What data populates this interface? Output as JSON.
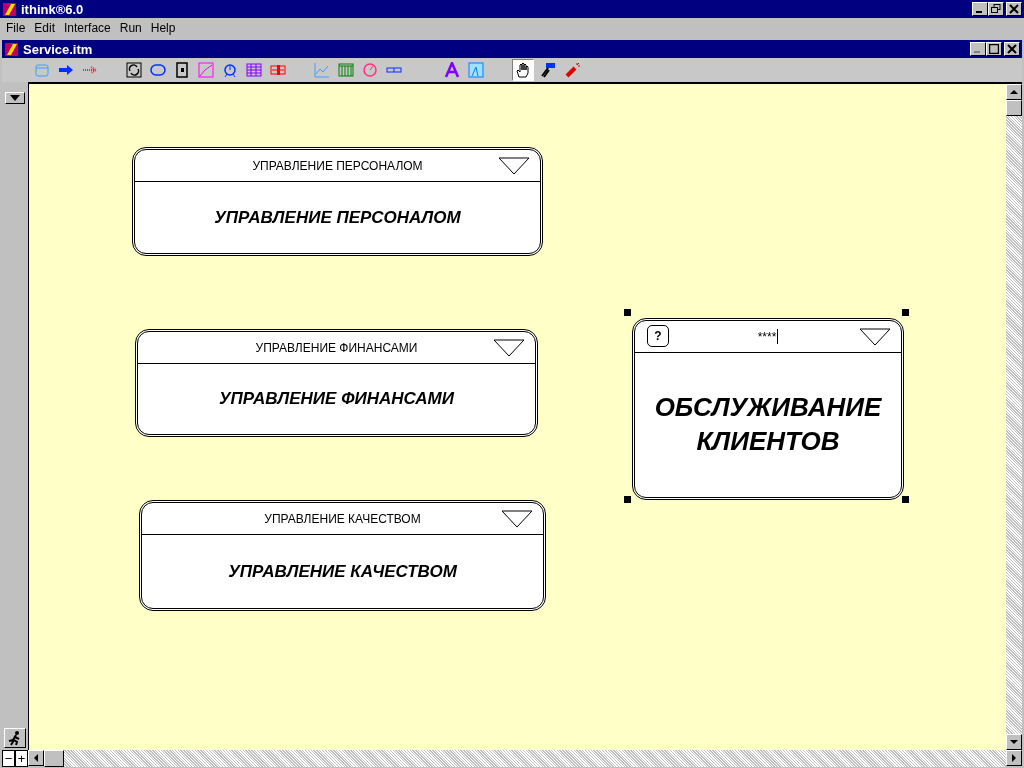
{
  "app_window": {
    "title": "ithink®6.0"
  },
  "menu": [
    "File",
    "Edit",
    "Interface",
    "Run",
    "Help"
  ],
  "document_window": {
    "title": "Service.itm"
  },
  "tools": [
    {
      "selected": true
    },
    {
      "selected": false
    },
    {
      "selected": false
    }
  ],
  "modules": [
    {
      "header": "УПРАВЛЕНИЕ ПЕРСОНАЛОМ",
      "title": "УПРАВЛЕНИЕ ПЕРСОНАЛОМ",
      "selected": false
    },
    {
      "header": "УПРАВЛЕНИЕ ФИНАНСАМИ",
      "title": "УПРАВЛЕНИЕ ФИНАНСАМИ",
      "selected": false
    },
    {
      "header": "УПРАВЛЕНИЕ КАЧЕСТВОМ",
      "title": "УПРАВЛЕНИЕ КАЧЕСТВОМ",
      "selected": false
    },
    {
      "header": "****",
      "title": "ОБСЛУЖИВАНИЕ КЛИЕНТОВ",
      "help": "?",
      "selected": true
    }
  ],
  "zoom_controls": [
    "−",
    "+"
  ]
}
